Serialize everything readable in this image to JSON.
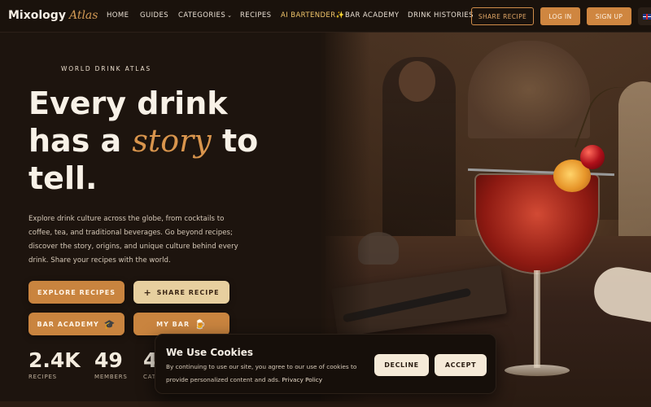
{
  "nav": {
    "logo_main": "Mixology",
    "logo_accent": "Atlas",
    "links": {
      "home": "HOME",
      "guides": "GUIDES",
      "categories": "CATEGORIES",
      "recipes": "RECIPES",
      "ai_bartender": "AI BARTENDER✨",
      "bar_academy": "BAR ACADEMY",
      "drink_histories": "DRINK HISTORIES"
    },
    "share_recipe": "SHARE RECIPE",
    "log_in": "LOG IN",
    "sign_up": "SIGN UP",
    "language_icon": "uk-flag-icon"
  },
  "hero": {
    "eyebrow": "WORLD DRINK ATLAS",
    "headline_line1": "Every drink",
    "headline_has_a": "has a ",
    "headline_story": "story",
    "headline_to": " to",
    "headline_line3": "tell.",
    "description": "Explore drink culture across the globe, from cocktails to coffee, tea, and traditional beverages. Go beyond recipes; discover the story, origins, and unique culture behind every drink. Share your recipes with the world.",
    "buttons": {
      "explore": "EXPLORE RECIPES",
      "share": "SHARE RECIPE",
      "academy": "BAR ACADEMY",
      "my_bar": "MY BAR"
    },
    "stats": [
      {
        "value": "2.4K",
        "label": "RECIPES"
      },
      {
        "value": "49",
        "label": "MEMBERS"
      },
      {
        "value": "4",
        "label": "CAT"
      }
    ]
  },
  "cookie": {
    "title": "We Use Cookies",
    "text": "By continuing to use our site, you agree to our use of cookies to provide personalized content and ads.",
    "policy_link": "Privacy Policy",
    "decline": "DECLINE",
    "accept": "ACCEPT"
  },
  "colors": {
    "accent": "#d39a55",
    "button_orange": "#c9843f",
    "button_cream": "#e7cf9f",
    "background": "#1d140e"
  }
}
